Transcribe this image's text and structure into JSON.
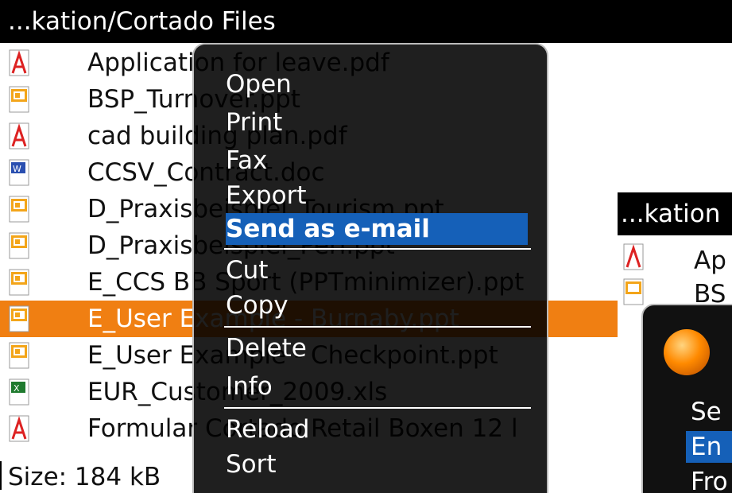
{
  "window": {
    "title": "...kation/Cortado Files"
  },
  "files": [
    {
      "name": "Application for leave.pdf",
      "type": "pdf"
    },
    {
      "name": "BSP_Turnover.ppt",
      "type": "ppt"
    },
    {
      "name": "cad building plan.pdf",
      "type": "pdf"
    },
    {
      "name": "CCSV_Contract.doc",
      "type": "doc"
    },
    {
      "name": "D_Praxisbeispiel_Tourism.ppt",
      "type": "ppt"
    },
    {
      "name": "D_Praxisbeispiel_Peri.ppt",
      "type": "ppt"
    },
    {
      "name": "E_CCS BB Sport (PPTminimizer).ppt",
      "type": "ppt"
    },
    {
      "name": "E_User Example - Burnaby.ppt",
      "type": "ppt",
      "selected": true
    },
    {
      "name": "E_User Example - Checkpoint.ppt",
      "type": "ppt"
    },
    {
      "name": "EUR_Customer_2009.xls",
      "type": "xls"
    },
    {
      "name": "Formular Cortado Retail Boxen 12 l",
      "type": "pdf"
    }
  ],
  "status": {
    "size": "Size: 184 kB"
  },
  "context_menu": {
    "items": [
      "Open",
      "Print",
      "Fax",
      "Export",
      "Send as e-mail",
      "Cut",
      "Copy",
      "Delete",
      "Info",
      "Reload",
      "Sort"
    ],
    "highlighted": "Send as e-mail"
  },
  "secondary_screen": {
    "title": "...kation",
    "rows": [
      "Ap",
      "BS"
    ],
    "popup_items": [
      "Se",
      "En",
      "Fro"
    ]
  },
  "icons": {
    "pdf": "pdf-file-icon",
    "ppt": "ppt-file-icon",
    "doc": "word-file-icon",
    "xls": "excel-file-icon"
  },
  "colors": {
    "selection": "#f07f12",
    "menu_highlight": "#1560b8",
    "title_bg": "#000000"
  }
}
